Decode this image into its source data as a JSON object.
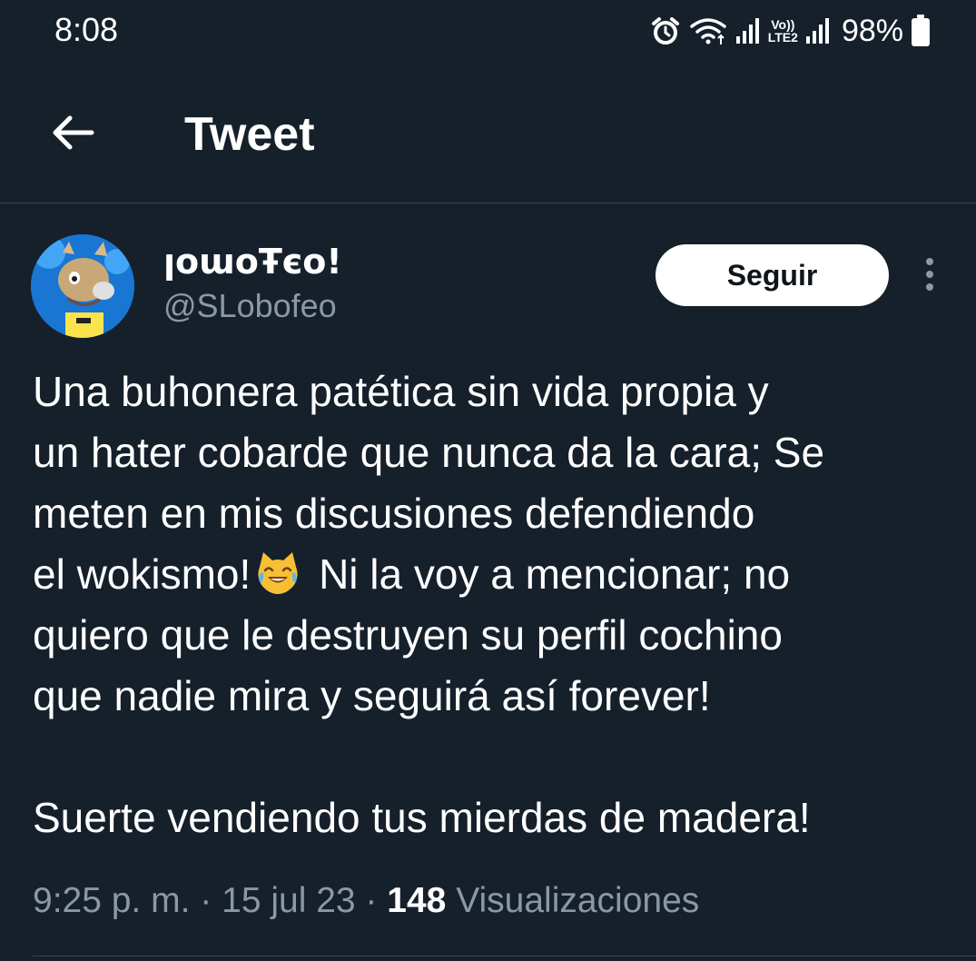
{
  "status_bar": {
    "time": "8:08",
    "battery": "98%",
    "volte_top": "Vo))",
    "volte_bottom": "LTE2",
    "icons": [
      "alarm-icon",
      "wifi-icon",
      "signal-icon",
      "volte-icon",
      "signal-icon",
      "battery-icon"
    ]
  },
  "header": {
    "title": "Tweet",
    "back_icon": "arrow-left-icon"
  },
  "tweet": {
    "author": {
      "display_name": "ꞁoɯoŦєo!",
      "handle": "@SLobofeo"
    },
    "follow_label": "Seguir",
    "more_icon": "more-vertical-icon",
    "text_lines": [
      "Una buhonera patética sin vida propia y",
      "un hater cobarde que nunca da la cara; Se",
      "meten en mis discusiones defendiendo",
      "el wokismo!",
      " Ni la voy a mencionar; no",
      "quiero que le destruyen su perfil cochino",
      "que nadie mira y seguirá así forever!",
      "Suerte vendiendo tus mierdas de madera!"
    ],
    "emoji": "cat-tears-of-joy-emoji",
    "time": "9:25 p. m.",
    "separator": "·",
    "date": "15 jul 23",
    "views_count": "148",
    "views_label": "Visualizaciones"
  },
  "colors": {
    "background": "#15202b",
    "text": "#ffffff",
    "secondary_text": "#8b98a5",
    "divider": "#38444d"
  }
}
